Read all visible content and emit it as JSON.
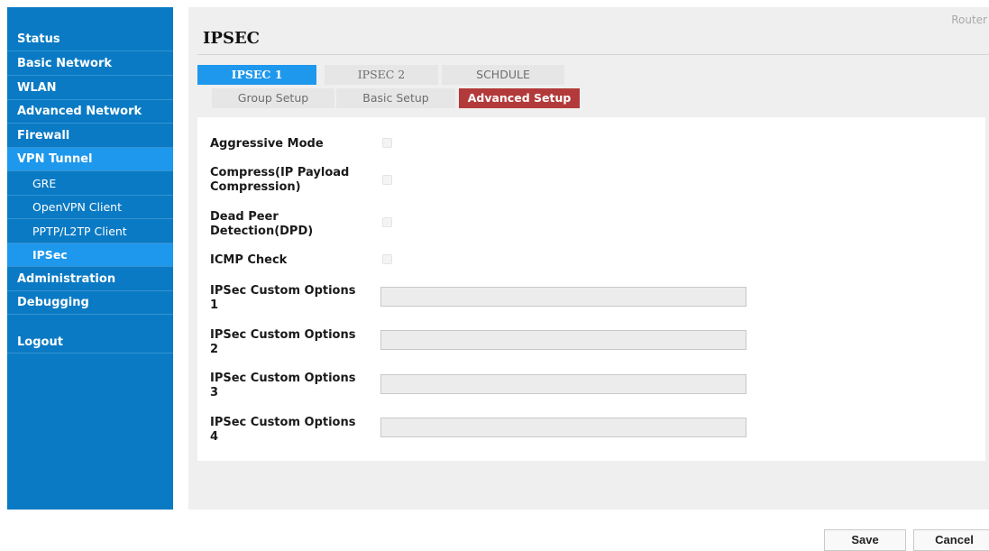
{
  "sidebar": {
    "items": [
      {
        "label": "Status"
      },
      {
        "label": "Basic Network"
      },
      {
        "label": "WLAN"
      },
      {
        "label": "Advanced Network"
      },
      {
        "label": "Firewall"
      },
      {
        "label": "VPN Tunnel"
      },
      {
        "label": "GRE"
      },
      {
        "label": "OpenVPN Client"
      },
      {
        "label": "PPTP/L2TP Client"
      },
      {
        "label": "IPSec"
      },
      {
        "label": "Administration"
      },
      {
        "label": "Debugging"
      },
      {
        "label": "Logout"
      }
    ]
  },
  "header": {
    "router_label": "Router",
    "title": "IPSEC"
  },
  "tabs": {
    "ipsec1": "IPSEC 1",
    "ipsec2": "IPSEC 2",
    "schedule": "SCHDULE"
  },
  "subtabs": {
    "group": "Group Setup",
    "basic": "Basic Setup",
    "advanced": "Advanced Setup"
  },
  "form": {
    "aggressive": "Aggressive Mode",
    "compress": "Compress(IP Payload Compression)",
    "dpd": "Dead Peer Detection(DPD)",
    "icmp": "ICMP Check",
    "opt1": "IPSec Custom Options 1",
    "opt2": "IPSec Custom Options 2",
    "opt3": "IPSec Custom Options 3",
    "opt4": "IPSec Custom Options 4",
    "values": {
      "opt1": "",
      "opt2": "",
      "opt3": "",
      "opt4": ""
    }
  },
  "buttons": {
    "save": "Save",
    "cancel": "Cancel"
  },
  "colors": {
    "sidebar": "#0a7ac4",
    "active_nav": "#1e98ec",
    "active_subtab": "#b33a3a"
  }
}
